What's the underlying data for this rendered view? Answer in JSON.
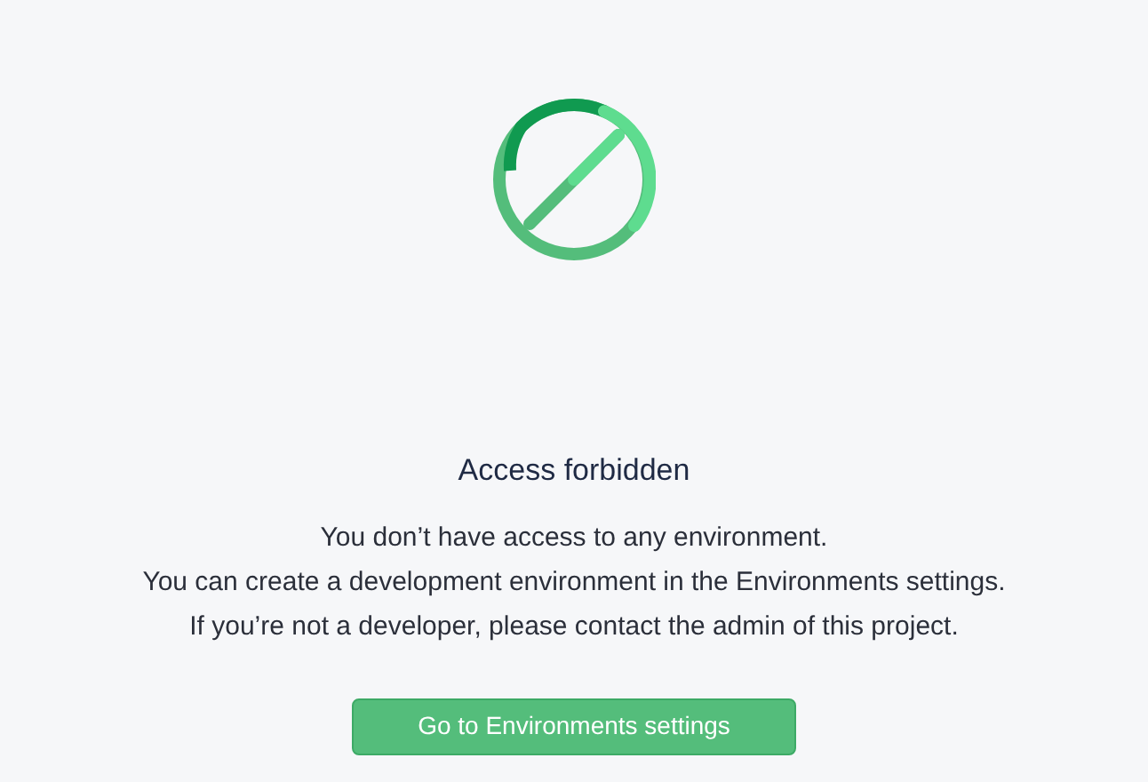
{
  "title": "Access forbidden",
  "message": [
    "You don’t have access to any environment.",
    "You can create a development environment in the Environments settings.",
    "If you’re not a developer, please contact the admin of this project."
  ],
  "button": {
    "label": "Go to Environments settings"
  }
}
